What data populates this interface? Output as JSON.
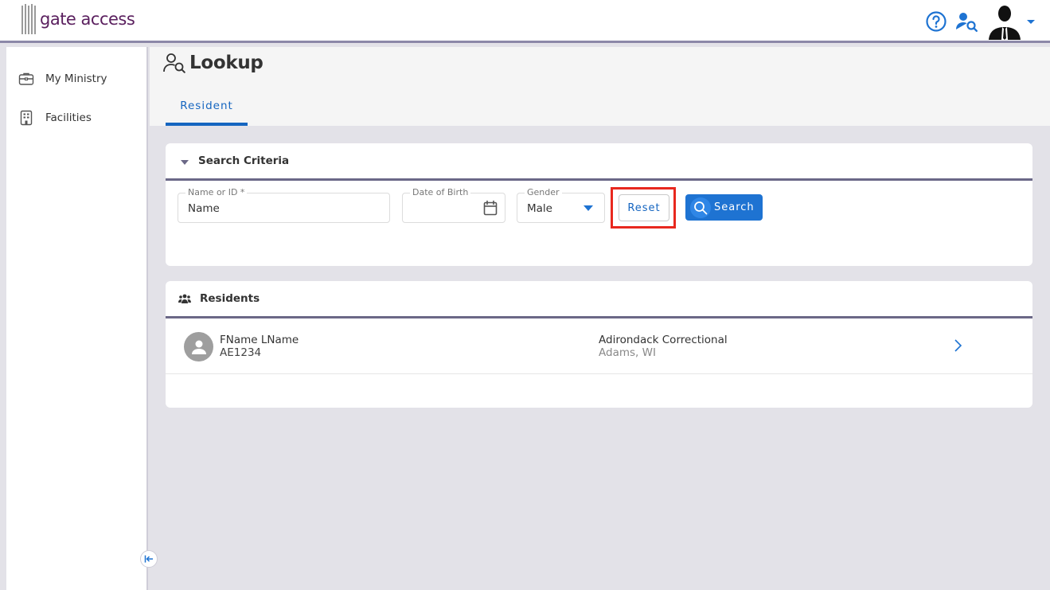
{
  "app": {
    "logo_text": "gate access"
  },
  "header": {
    "help_icon": "help-circle-icon",
    "lookup_icon": "user-search-icon",
    "avatar_icon": "user-avatar-icon"
  },
  "sidebar": {
    "items": [
      {
        "label": "My Ministry",
        "icon": "briefcase-icon"
      },
      {
        "label": "Facilities",
        "icon": "building-icon"
      }
    ],
    "collapse_icon": "collapse-left-icon"
  },
  "page": {
    "title": "Lookup",
    "tabs": [
      {
        "label": "Resident",
        "active": true
      }
    ]
  },
  "search": {
    "section_title": "Search Criteria",
    "name_label": "Name or ID *",
    "name_value": "Name",
    "dob_label": "Date of Birth",
    "dob_value": "",
    "gender_label": "Gender",
    "gender_value": "Male",
    "reset_label": "Reset",
    "search_label": "Search"
  },
  "residents": {
    "section_title": "Residents",
    "rows": [
      {
        "name": "FName LName",
        "id": "AE1234",
        "facility": "Adirondack Correctional",
        "location": "Adams, WI"
      }
    ]
  },
  "colors": {
    "accent": "#1565c0",
    "search_button": "#1e73d2",
    "highlight_box": "#e8281e",
    "logo": "#5a1f5e"
  }
}
